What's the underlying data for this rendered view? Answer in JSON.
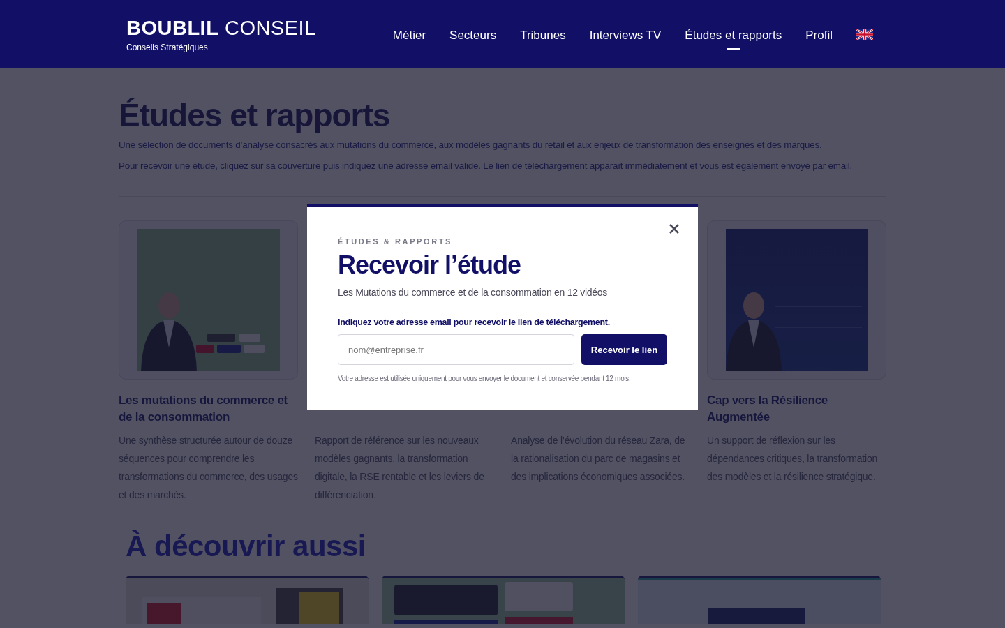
{
  "header": {
    "brand_bold": "BOUBLIL",
    "brand_light": "CONSEIL",
    "tagline": "Conseils Stratégiques",
    "nav": [
      {
        "label": "Métier",
        "selected": false
      },
      {
        "label": "Secteurs",
        "selected": false
      },
      {
        "label": "Tribunes",
        "selected": false
      },
      {
        "label": "Interviews TV",
        "selected": false
      },
      {
        "label": "Études et rapports",
        "selected": true
      },
      {
        "label": "Profil",
        "selected": false
      }
    ]
  },
  "page": {
    "title": "Études et rapports",
    "intro": [
      "Une sélection de documents d’analyse consacrés aux mutations du commerce, aux modèles gagnants du retail et aux enjeux de transformation des enseignes et des marques.",
      "Pour recevoir une étude, cliquez sur sa couverture puis indiquez une adresse email valide. Le lien de téléchargement apparaît immédiatement et vous est également envoyé par email."
    ]
  },
  "reports": [
    {
      "title": "Les mutations du commerce et de la consommation",
      "description": "Une synthèse structurée autour de douze séquences pour comprendre les transformations du commerce, des usages et des marchés."
    },
    {
      "description": "Rapport de référence sur les nouveaux modèles gagnants, la transformation digitale, la RSE rentable et les leviers de différenciation."
    },
    {
      "description": "Analyse de l’évolution du réseau Zara, de la rationalisation du parc de magasins et des implications économiques associées."
    },
    {
      "title": "Cap vers la Résilience Augmentée",
      "description": "Un support de réflexion sur les dépendances critiques, la transformation des modèles et la résilience stratégique."
    }
  ],
  "discover": {
    "title": "À découvrir aussi"
  },
  "modal": {
    "eyebrow": "ÉTUDES & RAPPORTS",
    "title": "Recevoir l’étude",
    "subtitle": "Les Mutations du commerce et de la consommation en 12 vidéos",
    "prompt": "Indiquez votre adresse email pour recevoir le lien de téléchargement.",
    "email_field": {
      "placeholder": "nom@entreprise.fr"
    },
    "submit": "Recevoir le lien",
    "note": "Votre adresse est utilisée uniquement pour vous envoyer le document et conservée pendant 12 mois."
  }
}
